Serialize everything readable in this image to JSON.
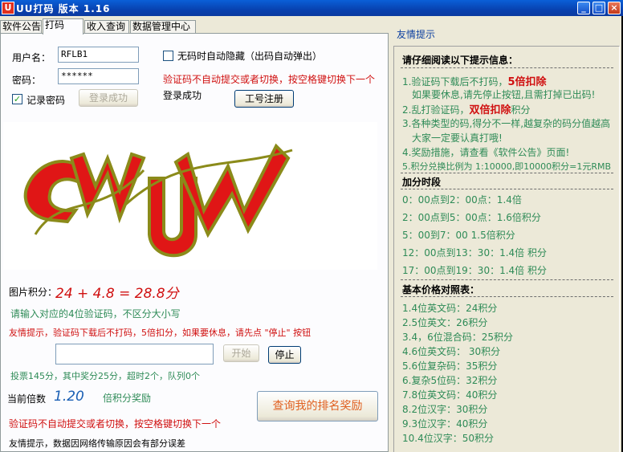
{
  "window": {
    "app_icon": "U",
    "title": "UU打码  版本  1.16",
    "min": "_",
    "max": "□",
    "close": "×"
  },
  "tabs": [
    "软件公告",
    "打码",
    "收入查询",
    "数据管理中心"
  ],
  "login": {
    "username_label": "用户名：",
    "username_value": "RFLB1",
    "password_label": "密码：",
    "password_value": "******",
    "remember_label": "记录密码",
    "remember_checked": "✓",
    "login_button": "登录成功",
    "auto_hide_label": "无码时自动隐藏（出码自动弹出）",
    "warning": "验证码不自动提交或者切换，按空格键切换下一个",
    "status": "登录成功",
    "register_button": "工号注册"
  },
  "captcha": {
    "text": "CUW",
    "colors": [
      "#e01616",
      "#8b8b1a"
    ]
  },
  "score": {
    "label": "图片积分：",
    "formula": "24  + 4.8 = 28.8分"
  },
  "instruction": "请输入对应的4位验证码，不区分大小写",
  "tip_stop": "友情提示，验证码下载后不打码，5倍扣分，如果要休息，请先点 \"停止\" 按钮",
  "input": {
    "value": "",
    "start_button": "开始",
    "stop_button": "停止"
  },
  "stats": "投票145分，其中奖分25分，超时2个，队列0个",
  "multiplier": {
    "label": "当前倍数",
    "value": "1.20",
    "suffix": "倍积分奖励"
  },
  "rank_button": "查询我的排名奖励",
  "footer_warning": "验证码不自动提交或者切换，按空格键切换下一个",
  "footer_tip": "友情提示，数据因网络传输原因会有部分误差",
  "right": {
    "title": "友情提示",
    "heading": "请仔细阅读以下提示信息：",
    "tip1a": "1.验证码下载后不打码，",
    "tip1b": "5倍扣除",
    "tip1c": "如果要休息,请先停止按钮,且需打掉已出码!",
    "tip2a": "2.乱打验证码，",
    "tip2b": "双倍扣除",
    "tip2c": "积分",
    "tip3a": "3.各种类型的码,得分不一样,越复杂的码分值越高",
    "tip3b": "大家一定要认真打哦!",
    "tip4": "4.奖励措施，请查看《软件公告》页面!",
    "tip5": "5.积分兑换比例为  1:10000,即10000积分=1元RMB",
    "bonus_heading": "加分时段",
    "bonus": [
      "0：00点到2：00点：1.4倍",
      "2：00点到5：00点：1.6倍积分",
      "5：00到7：00 1.5倍积分",
      "12：00点到13：30：1.4倍  积分",
      "17：00点到19：30：1.4倍  积分"
    ],
    "price_heading": "基本价格对照表：",
    "prices": [
      "1.4位英文码：24积分",
      "2.5位英文：26积分",
      "3.4，6位混合码：25积分",
      "4.6位英文码：  30积分",
      "5.6位复杂码：35积分",
      "6.复杂5位码：32积分",
      "7.8位英文码：40积分",
      "8.2位汉字：30积分",
      "9.3位汉字：40积分",
      "10.4位汉字：50积分"
    ]
  }
}
